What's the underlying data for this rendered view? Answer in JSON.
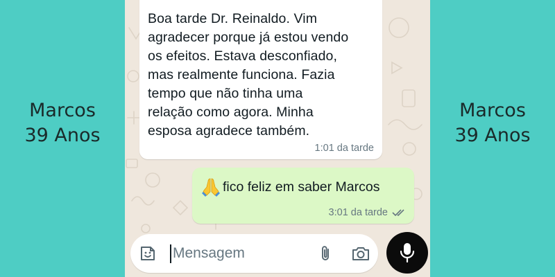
{
  "captions": {
    "left": {
      "line1": "Marcos",
      "line2": "39 Anos"
    },
    "right": {
      "line1": "Marcos",
      "line2": "39 Anos"
    }
  },
  "chat": {
    "incoming": {
      "text": "Boa tarde Dr. Reinaldo. Vim\nagradecer porque já estou vendo\nos efeitos. Estava desconfiado,\nmas realmente funciona. Fazia\ntempo que não tinha uma\nrelação como agora. Minha\nesposa agradece também.",
      "time": "1:01 da tarde"
    },
    "outgoing": {
      "emoji": "folded-hands-icon",
      "text": "fico feliz em saber Marcos",
      "time": "3:01 da tarde",
      "status": "read"
    }
  },
  "composer": {
    "placeholder": "Mensagem",
    "icons": [
      "sticker-icon",
      "paperclip-icon",
      "camera-icon",
      "microphone-icon"
    ]
  },
  "colors": {
    "background": "#4ecdc4",
    "chat_wallpaper": "#efe7dd",
    "outgoing_bubble": "#dcf8c6",
    "incoming_bubble": "#ffffff",
    "mic_button": "#0b0b0b"
  }
}
